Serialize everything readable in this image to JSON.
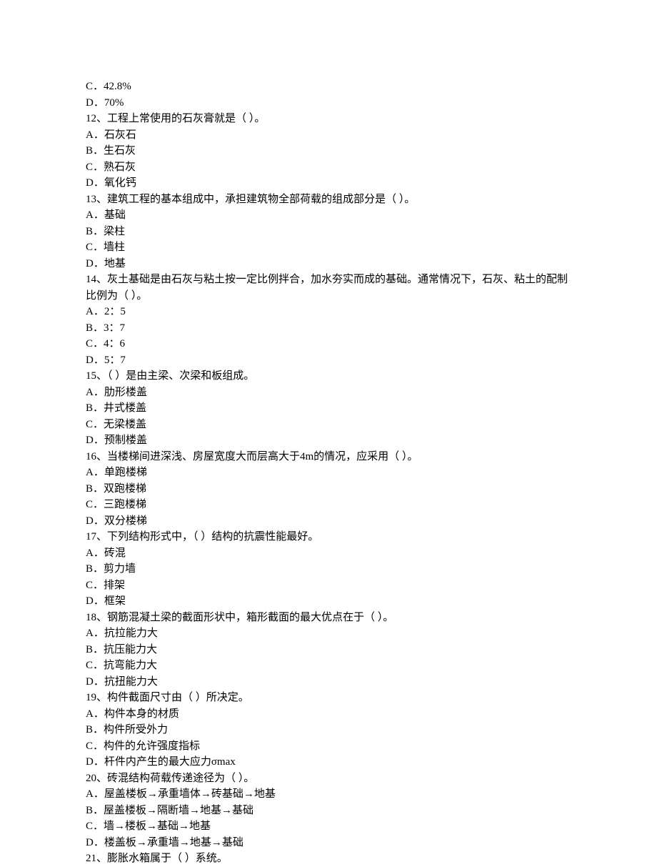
{
  "lines": [
    "C．42.8%",
    "D．70%",
    "12、工程上常使用的石灰膏就是（ ）。",
    "A．石灰石",
    "B．生石灰",
    "C．熟石灰",
    "D．氧化钙",
    "13、建筑工程的基本组成中，承担建筑物全部荷载的组成部分是（ ）。",
    "A．基础",
    "B．梁柱",
    "C．墙柱",
    "D．地基",
    "14、灰土基础是由石灰与粘土按一定比例拌合，加水夯实而成的基础。通常情况下，石灰、粘土的配制比例为（ ）。",
    "A．2：5",
    "B．3：7",
    "C．4：6",
    "D．5：7",
    "15、（ ）是由主梁、次梁和板组成。",
    "A．肋形楼盖",
    "B．井式楼盖",
    "C．无梁楼盖",
    "D．预制楼盖",
    "16、当楼梯间进深浅、房屋宽度大而层高大于4m的情况，应采用（ ）。",
    "A．单跑楼梯",
    "B．双跑楼梯",
    "C．三跑楼梯",
    "D．双分楼梯",
    "17、下列结构形式中，（ ）结构的抗震性能最好。",
    "A．砖混",
    "B．剪力墙",
    "C．排架",
    "D．框架",
    "18、钢筋混凝土梁的截面形状中，箱形截面的最大优点在于（ ）。",
    "A．抗拉能力大",
    "B．抗压能力大",
    "C．抗弯能力大",
    "D．抗扭能力大",
    "19、构件截面尺寸由（ ）所决定。",
    "A．构件本身的材质",
    "B．构件所受外力",
    "C．构件的允许强度指标",
    "D．杆件内产生的最大应力σmax",
    "20、砖混结构荷载传递途径为（ ）。",
    "A．屋盖楼板→承重墙体→砖基础→地基",
    "B．屋盖楼板→隔断墙→地基→基础",
    "C．墙→楼板→基础→地基",
    "D．楼盖板→承重墙→地基→基础",
    "21、膨胀水箱属于（ ）系统。"
  ]
}
